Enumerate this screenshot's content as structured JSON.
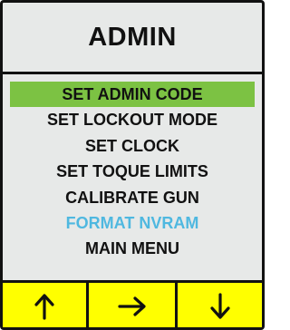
{
  "screen": {
    "title": "ADMIN"
  },
  "menu": {
    "items": [
      {
        "label": "SET ADMIN CODE",
        "state": "selected"
      },
      {
        "label": "SET LOCKOUT MODE",
        "state": "normal"
      },
      {
        "label": "SET CLOCK",
        "state": "normal"
      },
      {
        "label": "SET TOQUE LIMITS",
        "state": "normal"
      },
      {
        "label": "CALIBRATE GUN",
        "state": "normal"
      },
      {
        "label": "FORMAT NVRAM",
        "state": "highlighted-text"
      },
      {
        "label": "MAIN MENU",
        "state": "normal"
      }
    ]
  },
  "softkeys": [
    {
      "icon": "arrow-up-icon"
    },
    {
      "icon": "arrow-right-icon"
    },
    {
      "icon": "arrow-down-icon"
    }
  ],
  "colors": {
    "background": "#e7e9e8",
    "selection": "#7cc243",
    "accent_text": "#4fb8e0",
    "softkey_background": "#ffff00",
    "border": "#111111"
  }
}
